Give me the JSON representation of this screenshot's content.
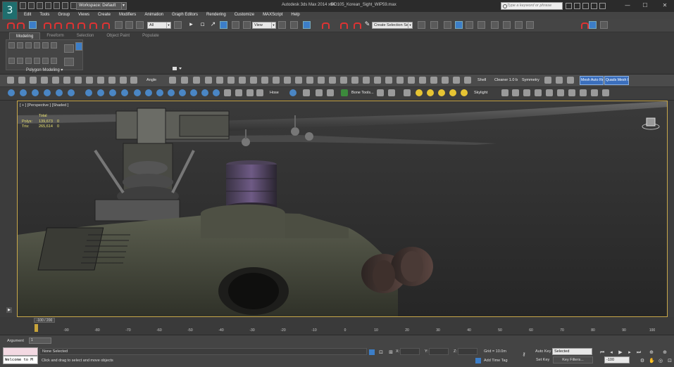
{
  "window": {
    "app_title": "Autodesk 3ds Max  2014 x64",
    "file_name": "BO105_Korean_Sight_WIP59.max",
    "workspace": "Workspace: Default",
    "search_placeholder": "Type a keyword or phrase",
    "minimize": "—",
    "maximize": "☐",
    "close": "✕"
  },
  "menu": [
    "Edit",
    "Tools",
    "Group",
    "Views",
    "Create",
    "Modifiers",
    "Animation",
    "Graph Editors",
    "Rendering",
    "Customize",
    "MAXScript",
    "Help"
  ],
  "main_toolbar": {
    "selection_filter": "All",
    "ref_coord": "View",
    "named_selection": "Create Selection Se"
  },
  "ribbon": {
    "tabs": [
      "Modeling",
      "Freeform",
      "Selection",
      "Object Paint",
      "Populate"
    ],
    "active_tab": "Modeling",
    "panel_label": "Polygon Modeling ▾"
  },
  "row1": {
    "angle_label": "Angle",
    "shell_label": "Shell",
    "cleaner_label": "Cleaner 1.0 b",
    "symmetry_label": "Symmetry",
    "btn_auto": "Mesh Auto Rel",
    "btn_mesh_insp": "Quads Mesh Insp"
  },
  "row2": {
    "hose_label": "Hose",
    "bone_tools_label": "Bone Tools...",
    "skylight_label": "Skylight"
  },
  "viewport": {
    "label": "[ + ] [Perspective ] [Shaded ]",
    "stats": {
      "header": "Total",
      "polys_label": "Polys:",
      "polys_value": "139,673",
      "polys_sel": "0",
      "tris_label": "Tris:",
      "tris_value": "265,614",
      "tris_sel": "0"
    }
  },
  "timeline": {
    "frame_display": "-100 / 200",
    "ticks": [
      "-90",
      "-80",
      "-70",
      "-60",
      "-50",
      "-40",
      "-30",
      "-20",
      "-10",
      "0",
      "10",
      "20",
      "30",
      "40",
      "50",
      "60",
      "70",
      "80",
      "90",
      "100"
    ]
  },
  "status": {
    "argument_label": "Argument",
    "argument_value": "1",
    "listener_text": "Welcome to M",
    "selection_status": "None Selected",
    "prompt": "Click and drag to select and move objects",
    "x_label": "X:",
    "y_label": "Y:",
    "z_label": "Z:",
    "grid": "Grid = 10.0m",
    "add_time_tag": "Add Time Tag",
    "auto_key": "Auto Key",
    "set_key": "Set Key",
    "selected_dropdown": "Selected",
    "key_filters": "Key Filters...",
    "current_frame": "-100"
  },
  "colors": {
    "accent_blue": "#3c7ec8",
    "viewport_border": "#c9a84a",
    "stats_text": "#e8e070"
  }
}
